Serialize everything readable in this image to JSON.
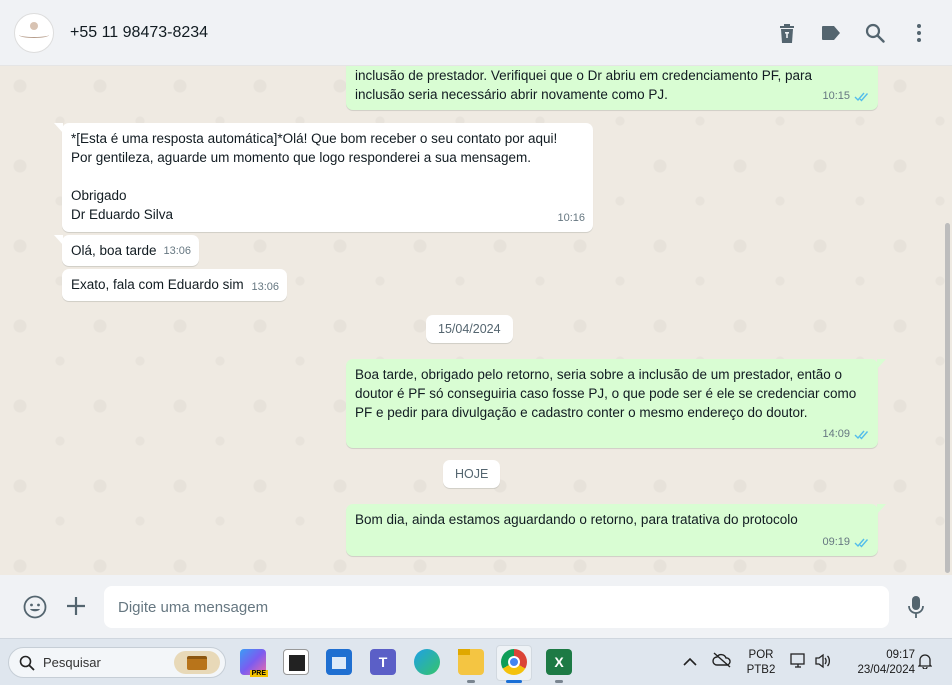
{
  "header": {
    "contact_name": "+55 11 98473-8234",
    "icons": [
      "delete-icon",
      "label-icon",
      "search-icon",
      "menu-icon"
    ]
  },
  "messages": [
    {
      "direction": "out",
      "text": "inclusão de prestador. Verifiquei que o Dr abriu em credenciamento PF, para\ninclusão seria necessário abrir novamente como PJ.",
      "time": "10:15",
      "status": "read"
    },
    {
      "direction": "in",
      "text": "*[Esta é uma resposta automática]*Olá! Que bom receber o seu contato por aqui!\nPor gentileza, aguarde um momento que logo responderei a sua mensagem.\n\nObrigado\nDr Eduardo Silva",
      "time": "10:16"
    },
    {
      "direction": "in",
      "text": "Olá, boa tarde",
      "time": "13:06"
    },
    {
      "direction": "in",
      "text": "Exato, fala com Eduardo sim",
      "time": "13:06"
    },
    {
      "direction": "out",
      "text": "Boa tarde, obrigado pelo retorno, seria sobre a inclusão de um prestador, então o\ndoutor é PF só conseguiria caso fosse PJ, o que pode ser é ele se credenciar como\nPF e pedir para divulgação e cadastro conter o mesmo endereço do doutor.",
      "time": "14:09",
      "status": "read"
    },
    {
      "direction": "out",
      "text": "Bom dia, ainda estamos aguardando o retorno, para tratativa do protocolo",
      "time": "09:19",
      "status": "read"
    }
  ],
  "date_separators": [
    "15/04/2024",
    "HOJE"
  ],
  "composer": {
    "placeholder": "Digite uma mensagem",
    "icons": [
      "emoji-icon",
      "plus-icon",
      "microphone-icon"
    ]
  },
  "taskbar": {
    "search_label": "Pesquisar",
    "language_line1": "POR",
    "language_line2": "PTB2",
    "time": "09:17",
    "date": "23/04/2024",
    "apps": [
      "work-briefcase-icon",
      "copilot-icon",
      "task-view-icon",
      "microsoft-store-icon",
      "teams-icon",
      "edge-icon",
      "file-explorer-icon",
      "chrome-icon",
      "excel-icon"
    ]
  },
  "colors": {
    "outgoing_bubble": "#d9fdd3",
    "incoming_bubble": "#ffffff",
    "chat_background": "#efeae2",
    "read_ticks": "#53bdeb"
  }
}
